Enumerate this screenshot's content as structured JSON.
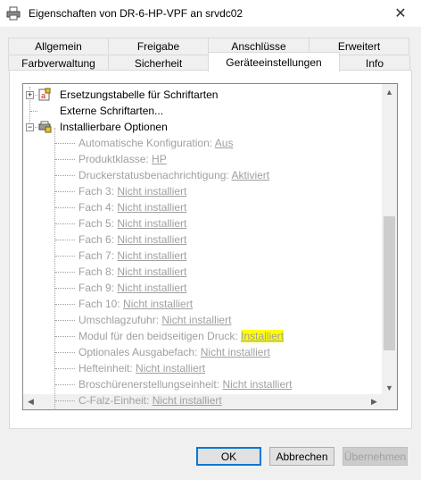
{
  "window": {
    "title": "Eigenschaften von DR-6-HP-VPF an srvdc02",
    "close_glyph": "✕"
  },
  "tabs_row1": [
    {
      "label": "Allgemein"
    },
    {
      "label": "Freigabe"
    },
    {
      "label": "Anschlüsse"
    },
    {
      "label": "Erweitert"
    }
  ],
  "tabs_row2": [
    {
      "label": "Farbverwaltung"
    },
    {
      "label": "Sicherheit"
    },
    {
      "label": "Geräteeinstellungen",
      "active": true
    },
    {
      "label": "Info"
    }
  ],
  "tree": {
    "top": [
      {
        "label": "Ersetzungstabelle für Schriftarten",
        "expander": "+"
      },
      {
        "label": "Externe Schriftarten..."
      },
      {
        "label": "Installierbare Optionen",
        "expander": "−"
      }
    ],
    "options": [
      {
        "label": "Automatische Konfiguration: ",
        "value": "Aus"
      },
      {
        "label": "Produktklasse: ",
        "value": "HP"
      },
      {
        "label": "Druckerstatusbenachrichtigung: ",
        "value": "Aktiviert"
      },
      {
        "label": "Fach 3: ",
        "value": "Nicht installiert"
      },
      {
        "label": "Fach 4: ",
        "value": "Nicht installiert"
      },
      {
        "label": "Fach 5: ",
        "value": "Nicht installiert"
      },
      {
        "label": "Fach 6: ",
        "value": "Nicht installiert"
      },
      {
        "label": "Fach 7: ",
        "value": "Nicht installiert"
      },
      {
        "label": "Fach 8: ",
        "value": "Nicht installiert"
      },
      {
        "label": "Fach 9: ",
        "value": "Nicht installiert"
      },
      {
        "label": "Fach 10: ",
        "value": "Nicht installiert"
      },
      {
        "label": "Umschlagzufuhr: ",
        "value": "Nicht installiert"
      },
      {
        "label": "Modul für den beidseitigen Druck: ",
        "value": "Installiert",
        "highlight": true
      },
      {
        "label": "Optionales Ausgabefach: ",
        "value": "Nicht installiert"
      },
      {
        "label": "Hefteinheit: ",
        "value": "Nicht installiert"
      },
      {
        "label": "Broschürenerstellungseinheit: ",
        "value": "Nicht installiert"
      },
      {
        "label": "C-Falz-Einheit: ",
        "value": "Nicht installiert"
      }
    ]
  },
  "buttons": {
    "ok": "OK",
    "cancel": "Abbrechen",
    "apply": "Übernehmen"
  },
  "colors": {
    "highlight": "#ffff00",
    "disabled_text": "#a0a0a0",
    "accent": "#0078d7"
  }
}
